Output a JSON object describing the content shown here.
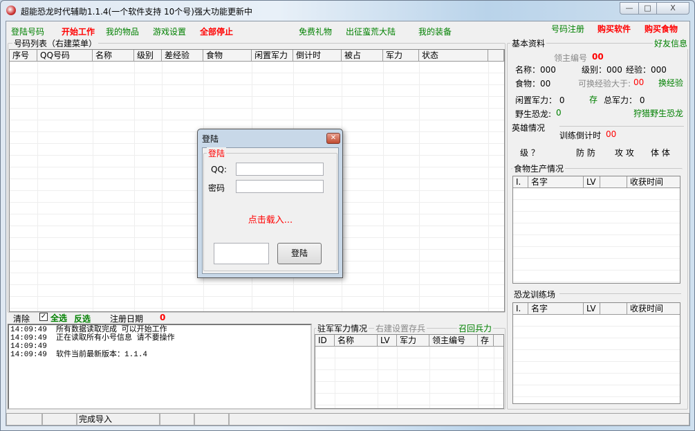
{
  "window": {
    "title": "超能恐龙时代辅助1.1.4(一个软件支持 10个号)强大功能更新中",
    "minimize": "—",
    "maximize": "□",
    "close": "X"
  },
  "menu": [
    {
      "label": "登陆号码",
      "color": "green"
    },
    {
      "label": "开始工作",
      "color": "red"
    },
    {
      "label": "我的物品",
      "color": "green"
    },
    {
      "label": "游戏设置",
      "color": "green"
    },
    {
      "label": "全部停止",
      "color": "red"
    },
    {
      "label": "免费礼物",
      "color": "green"
    },
    {
      "label": "出征蛮荒大陆",
      "color": "green"
    },
    {
      "label": "我的装备",
      "color": "green"
    },
    {
      "label": "号码注册",
      "color": "green"
    },
    {
      "label": "购买软件",
      "color": "red"
    },
    {
      "label": "购买食物",
      "color": "red"
    }
  ],
  "account_list": {
    "title": "号码列表（右建菜单）",
    "columns": [
      "序号",
      "QQ号码",
      "名称",
      "级别",
      "差经验",
      "食物",
      "闲置军力",
      "倒计时",
      "被占",
      "军力",
      "状态",
      ""
    ]
  },
  "bottom_bar": {
    "clear": "清除",
    "select_all": "全选",
    "select_all_checked": true,
    "invert": "反选",
    "reg_date_label": "注册日期",
    "reg_date_value": "0"
  },
  "log": [
    {
      "time": "14:09:49",
      "msg": "所有数据读取完成 可以开始工作"
    },
    {
      "time": "14:09:49",
      "msg": "正在读取所有小号信息 请不要操作"
    },
    {
      "time": "14:09:49",
      "msg": ""
    },
    {
      "time": "14:09:49",
      "msg": "软件当前最新版本：1.1.4"
    }
  ],
  "garrison": {
    "title": "驻军军力情况",
    "hint": "右建设置存兵",
    "recall": "召回兵力",
    "columns": [
      "ID",
      "名称",
      "LV",
      "军力",
      "领主编号",
      "存"
    ]
  },
  "status_bar": [
    "",
    "",
    "完成导入",
    "",
    "",
    ""
  ],
  "basic": {
    "title": "基本资料",
    "friend_info": "好友信息",
    "lord_id_label": "领主编号",
    "lord_id": "00",
    "name_label": "名称：000",
    "level_label": "级别：000",
    "exp_label": "经验：000",
    "food_label": "食物：00",
    "exchange_label": "可换经验大于:",
    "exchange_value": "00",
    "exchange_btn": "换经验",
    "idle_label": "闲置军力： 0",
    "store_btn": "存",
    "total_label": "总军力： 0",
    "wild_label": "野生恐龙:",
    "wild_value": "0",
    "hunt_btn": "狩猎野生恐龙"
  },
  "hero": {
    "title": "英雄情况",
    "train_label": "训练倒计时",
    "train_value": "00",
    "level": "级 ？",
    "def": "防 防",
    "atk": "攻 攻",
    "hp": "体 体"
  },
  "food_prod": {
    "title": "食物生产情况",
    "columns": [
      "I.",
      "名字",
      "LV",
      "",
      "收获时间"
    ]
  },
  "training": {
    "title": "恐龙训练场",
    "columns": [
      "I.",
      "名字",
      "LV",
      "",
      "收获时间"
    ]
  },
  "login_dialog": {
    "title": "登陆",
    "group": "登陆",
    "qq_label": "QQ:",
    "qq_value": "",
    "pwd_label": "密码",
    "pwd_value": "",
    "loading": "点击载入...",
    "captcha_value": "",
    "login_btn": "登陆",
    "close": "✕"
  }
}
